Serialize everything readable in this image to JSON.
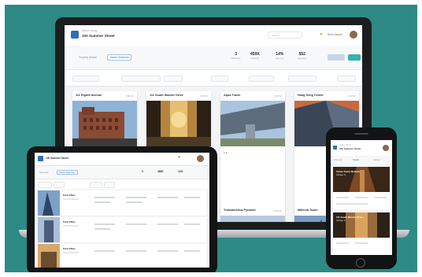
{
  "scene": {
    "background_color": "#2d8a85",
    "accent_color": "#34b3a8",
    "brand_color": "#2f6fb7"
  },
  "laptop": {
    "header": {
      "subtitle": "Avison Young",
      "title": "100 Summer Street",
      "search_placeholder": "Search",
      "user_name": "Brent Sawyer"
    },
    "filters": {
      "tab_a": "Property Search",
      "tab_b": "Saved Searches"
    },
    "stats": [
      {
        "value": "3",
        "label": "Buildings"
      },
      {
        "value": "450K",
        "label": "Total SF"
      },
      {
        "value": "14%",
        "label": "Vacancy"
      },
      {
        "value": "$52",
        "label": "Avg Rent"
      }
    ],
    "cards": [
      {
        "name": "111 Eighth Avenue",
        "meta": "1.8M SF"
      },
      {
        "name": "111 South Wacker Drive",
        "meta": "1.0M SF"
      },
      {
        "name": "Aqua Tower",
        "meta": "1.9M SF"
      },
      {
        "name": "Hang Seng Center",
        "meta": "2.1M SF"
      }
    ],
    "second_row": [
      {
        "name": "Transamerica Pyramid",
        "meta": "0.5M SF"
      },
      {
        "name": "Millenia Tower",
        "meta": "1.1M SF"
      }
    ]
  },
  "tablet": {
    "title": "100 Summer Street",
    "tab_a": "Overview",
    "tab_b": "Saved Searches",
    "stats": [
      "3",
      "450K",
      "14%"
    ],
    "rows": [
      {
        "name": "Park Office"
      },
      {
        "name": "Park Office"
      },
      {
        "name": "Park Office"
      }
    ]
  },
  "phone": {
    "subtitle": "Avison Young",
    "title": "100 Summer Street",
    "tabs": [
      "Overview",
      "Details",
      "Listings"
    ],
    "cards": [
      {
        "name": "Vistas Tower Bullock",
        "meta": "Chicago, IL"
      },
      {
        "name": "111 South Wacker Drive",
        "meta": "Chicago, IL"
      }
    ]
  }
}
